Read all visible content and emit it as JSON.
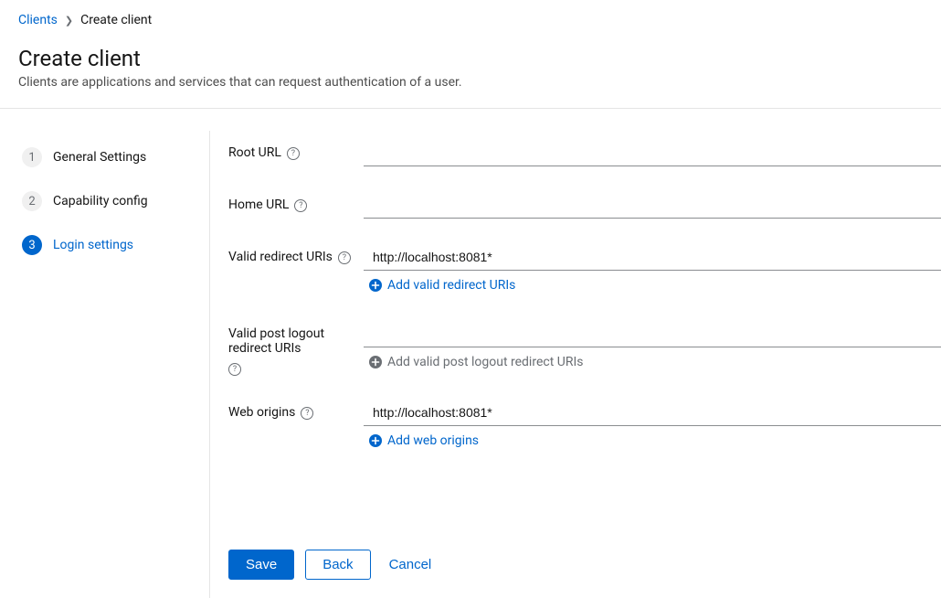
{
  "breadcrumb": {
    "parent": "Clients",
    "current": "Create client"
  },
  "header": {
    "title": "Create client",
    "description": "Clients are applications and services that can request authentication of a user."
  },
  "wizard": {
    "steps": [
      {
        "num": "1",
        "label": "General Settings"
      },
      {
        "num": "2",
        "label": "Capability config"
      },
      {
        "num": "3",
        "label": "Login settings"
      }
    ]
  },
  "form": {
    "root_url": {
      "label": "Root URL",
      "value": ""
    },
    "home_url": {
      "label": "Home URL",
      "value": ""
    },
    "valid_redirect_uris": {
      "label": "Valid redirect URIs",
      "value": "http://localhost:8081*",
      "add_label": "Add valid redirect URIs"
    },
    "valid_post_logout_redirect_uris": {
      "label": "Valid post logout redirect URIs",
      "value": "",
      "add_label": "Add valid post logout redirect URIs"
    },
    "web_origins": {
      "label": "Web origins",
      "value": "http://localhost:8081*",
      "add_label": "Add web origins"
    }
  },
  "actions": {
    "save": "Save",
    "back": "Back",
    "cancel": "Cancel"
  }
}
